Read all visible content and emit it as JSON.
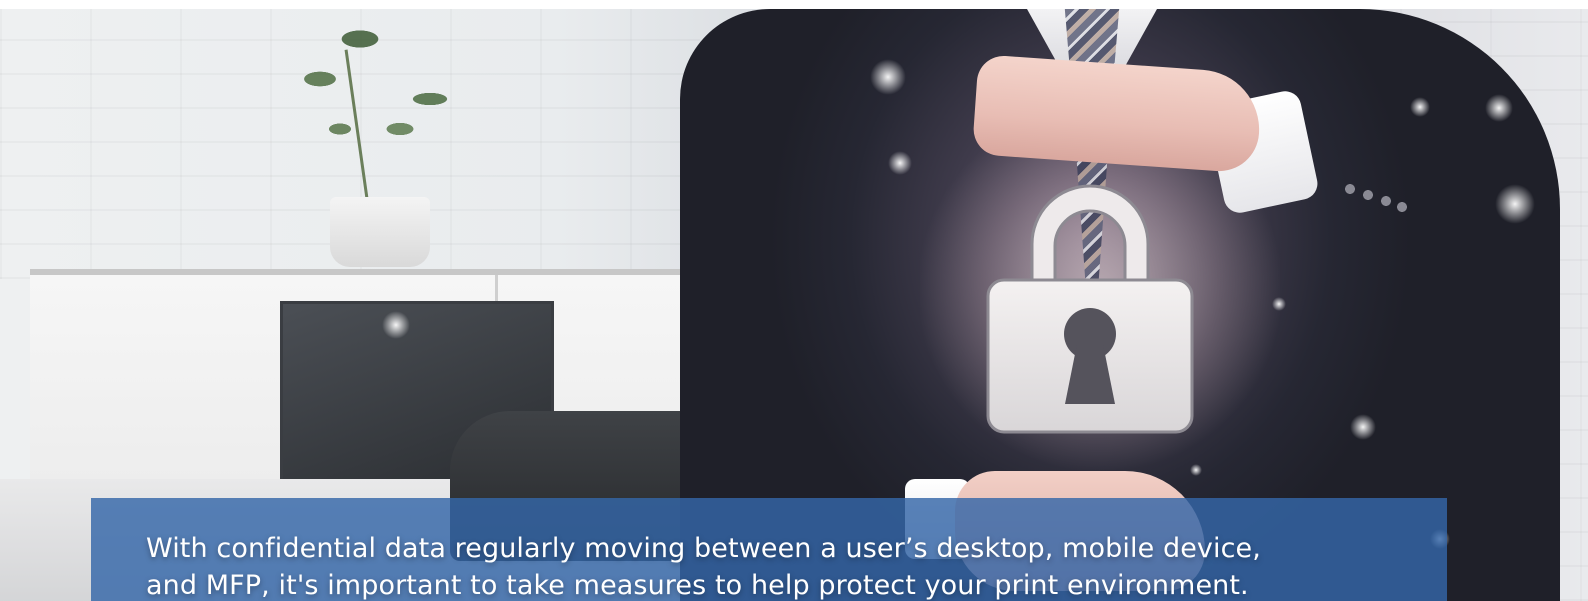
{
  "hero": {
    "image_alt": "",
    "icon": "padlock-icon"
  },
  "caption": {
    "line1": "With confidential data regularly moving between a user’s desktop, mobile device,",
    "line2": "and MFP, it's important to take measures to help protect your print environment."
  },
  "colors": {
    "caption_background": "#3566A8",
    "caption_text": "#FFFFFF"
  }
}
